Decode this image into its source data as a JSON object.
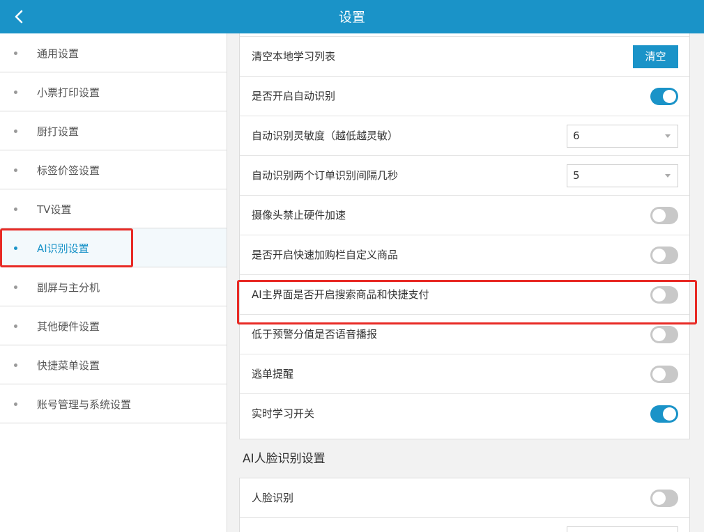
{
  "header": {
    "title": "设置",
    "back_icon": "chevron-left-icon"
  },
  "sidebar": {
    "items": [
      {
        "label": "通用设置",
        "active": false
      },
      {
        "label": "小票打印设置",
        "active": false
      },
      {
        "label": "厨打设置",
        "active": false
      },
      {
        "label": "标签价签设置",
        "active": false
      },
      {
        "label": "TV设置",
        "active": false
      },
      {
        "label": "AI识别设置",
        "active": true
      },
      {
        "label": "副屏与主分机",
        "active": false
      },
      {
        "label": "其他硬件设置",
        "active": false
      },
      {
        "label": "快捷菜单设置",
        "active": false
      },
      {
        "label": "账号管理与系统设置",
        "active": false
      }
    ]
  },
  "ai_settings": {
    "clear_local": {
      "label": "清空本地学习列表",
      "button": "清空"
    },
    "auto_recognize": {
      "label": "是否开启自动识别",
      "on": true
    },
    "sensitivity": {
      "label": "自动识别灵敏度（越低越灵敏）",
      "value": "6"
    },
    "interval": {
      "label": "自动识别两个订单识别间隔几秒",
      "value": "5"
    },
    "camera_hw_accel": {
      "label": "摄像头禁止硬件加速",
      "on": false
    },
    "quick_cart_custom": {
      "label": "是否开启快速加购栏自定义商品",
      "on": false
    },
    "main_search_pay": {
      "label": "AI主界面是否开启搜索商品和快捷支付",
      "on": false
    },
    "voice_alert": {
      "label": "低于预警分值是否语音播报",
      "on": false
    },
    "skip_order_alert": {
      "label": "逃单提醒",
      "on": false
    },
    "realtime_learning": {
      "label": "实时学习开关",
      "on": true
    }
  },
  "face_settings": {
    "section_title": "AI人脸识别设置",
    "face_recognition": {
      "label": "人脸识别",
      "on": false
    }
  },
  "colors": {
    "accent": "#1a93c8",
    "highlight": "#e82a25"
  }
}
